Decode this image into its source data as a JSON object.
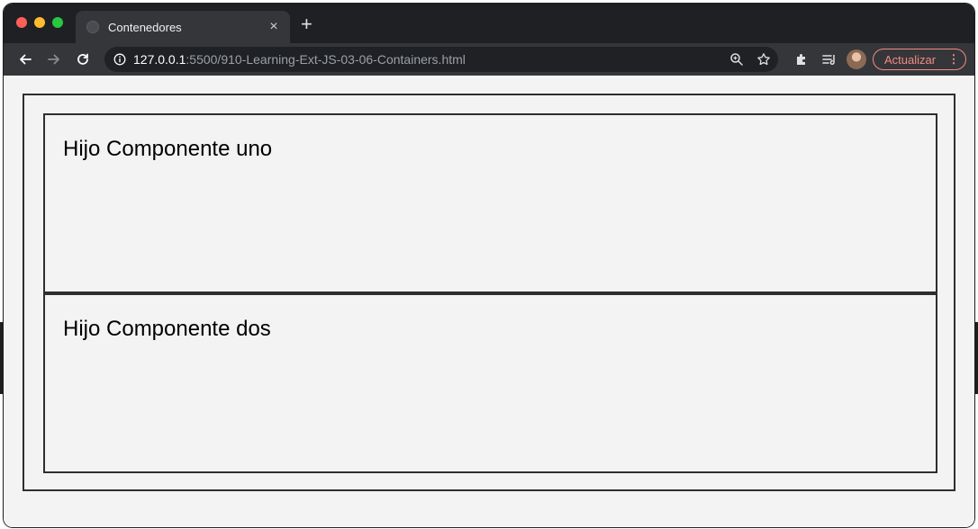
{
  "browser": {
    "tab_title": "Contenedores",
    "tab_close_glyph": "×",
    "new_tab_glyph": "+",
    "url_host": "127.0.0.1",
    "url_path": ":5500/910-Learning-Ext-JS-03-06-Containers.html",
    "update_button_label": "Actualizar",
    "update_menu_glyph": "⋮"
  },
  "page": {
    "children": [
      {
        "label": "Hijo Componente uno"
      },
      {
        "label": "Hijo Componente dos"
      }
    ]
  },
  "colors": {
    "titlebar": "#1f2023",
    "toolbar": "#35363a",
    "omnibox": "#202124",
    "accent_update": "#f28b82",
    "page_background": "#f3f3f3",
    "border": "#2e2e2e"
  },
  "icons": [
    "back-arrow-icon",
    "forward-arrow-icon",
    "reload-icon",
    "info-icon",
    "zoom-icon",
    "star-icon",
    "extensions-icon",
    "reading-list-icon"
  ]
}
